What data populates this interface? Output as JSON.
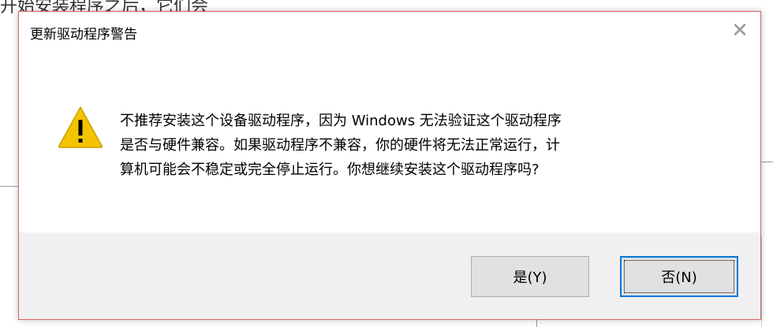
{
  "background": {
    "top_text": "开始安装程序之后，它们会"
  },
  "dialog": {
    "title": "更新驱动程序警告",
    "close_glyph": "✕",
    "icon": "warning-icon",
    "message_lines": [
      "不推荐安装这个设备驱动程序，因为 Windows 无法验证这个驱动程序",
      "是否与硬件兼容。如果驱动程序不兼容，你的硬件将无法正常运行，计",
      "算机可能会不稳定或完全停止运行。你想继续安装这个驱动程序吗?"
    ],
    "buttons": {
      "yes": "是(Y)",
      "no": "否(N)"
    }
  },
  "colors": {
    "accent_focus": "#0078d7",
    "dialog_border": "#e06060",
    "footer_bg": "#f0f0f0",
    "warning_yellow": "#f5c400"
  }
}
